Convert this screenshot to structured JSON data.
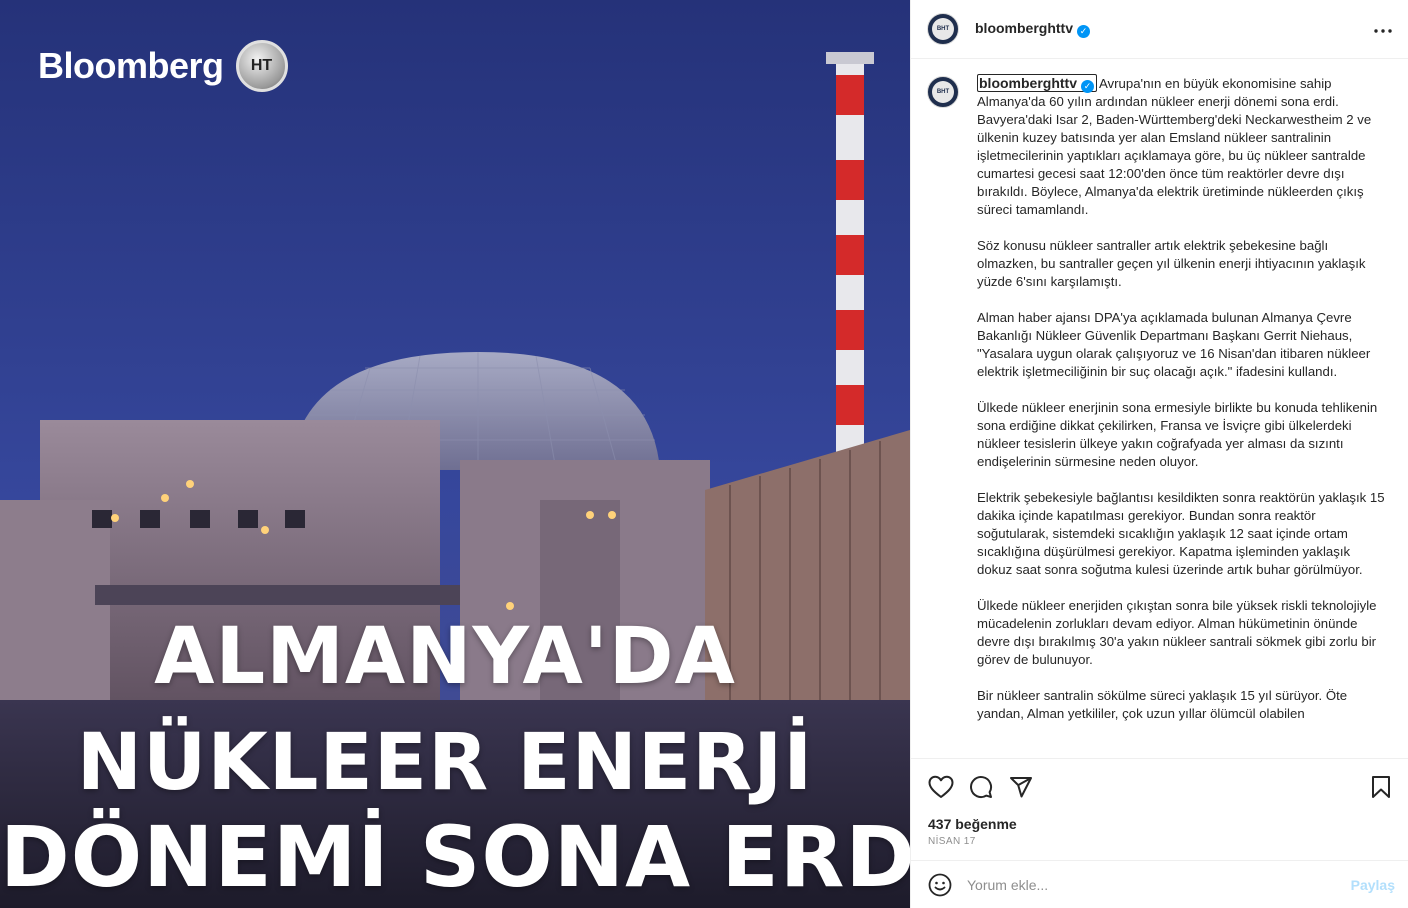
{
  "media": {
    "brand": "Bloomberg",
    "brand_badge": "HT",
    "headline_lines": [
      "ALMANYA'DA",
      "NÜKLEER ENERJİ",
      "DÖNEMİ SONA ERDİ"
    ]
  },
  "post": {
    "username": "bloomberghttv",
    "verified_mark": "✓",
    "more_icon": "more-horizontal-icon",
    "caption_paragraphs": [
      "Avrupa'nın en büyük ekonomisine sahip Almanya'da 60 yılın ardından nükleer enerji dönemi sona erdi. Bavyera'daki Isar 2, Baden-Württemberg'deki Neckarwestheim 2 ve ülkenin kuzey batısında yer alan Emsland nükleer santralinin işletmecilerinin yaptıkları açıklamaya göre, bu üç nükleer santralde cumartesi gecesi saat 12:00'den önce tüm reaktörler devre dışı bırakıldı. Böylece, Almanya'da elektrik üretiminde nükleerden çıkış süreci tamamlandı.",
      "Söz konusu nükleer santraller artık elektrik şebekesine bağlı olmazken, bu santraller geçen yıl ülkenin enerji ihtiyacının yaklaşık yüzde 6'sını karşılamıştı.",
      "Alman haber ajansı DPA'ya açıklamada bulunan Almanya Çevre Bakanlığı Nükleer Güvenlik Departmanı Başkanı Gerrit Niehaus, \"Yasalara uygun olarak çalışıyoruz ve 16 Nisan'dan itibaren nükleer elektrik işletmeciliğinin bir suç olacağı açık.\" ifadesini kullandı.",
      "Ülkede nükleer enerjinin sona ermesiyle birlikte bu konuda tehlikenin sona erdiğine dikkat çekilirken, Fransa ve İsviçre gibi ülkelerdeki nükleer tesislerin ülkeye yakın coğrafyada yer alması da sızıntı endişelerinin sürmesine neden oluyor.",
      "Elektrik şebekesiyle bağlantısı kesildikten sonra reaktörün yaklaşık 15 dakika içinde kapatılması gerekiyor. Bundan sonra reaktör soğutularak, sistemdeki sıcaklığın yaklaşık 12 saat içinde ortam sıcaklığına düşürülmesi gerekiyor. Kapatma işleminden yaklaşık dokuz saat sonra soğutma kulesi üzerinde artık buhar görülmüyor.",
      "Ülkede nükleer enerjiden çıkıştan sonra bile yüksek riskli teknolojiyle mücadelenin zorlukları devam ediyor. Alman hükümetinin önünde devre dışı bırakılmış 30'a yakın nükleer santrali sökmek gibi zorlu bir görev de bulunuyor.",
      "Bir nükleer santralin sökülme süreci yaklaşık 15 yıl sürüyor. Öte yandan, Alman yetkililer, çok uzun yıllar ölümcül olabilen"
    ],
    "likes": "437 beğenme",
    "date": "NİSAN 17"
  },
  "actions": {
    "like_icon": "heart-icon",
    "comment_icon": "comment-icon",
    "share_icon": "share-icon",
    "save_icon": "bookmark-icon"
  },
  "comment": {
    "placeholder": "Yorum ekle...",
    "post_label": "Paylaş",
    "emoji_icon": "emoji-icon"
  },
  "colors": {
    "sky": "#2c3a8a",
    "accent_blue": "#0095f6",
    "post_disabled": "#b2dffc",
    "chimney_red": "#d42a2a"
  }
}
